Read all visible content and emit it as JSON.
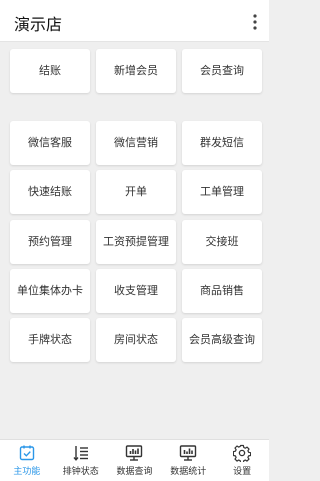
{
  "header": {
    "title": "演示店",
    "menu_icon": "more-vertical-icon"
  },
  "tiles": [
    {
      "label": "结账"
    },
    {
      "label": "新增会员"
    },
    {
      "label": "会员查询"
    },
    {
      "label": "微信客服"
    },
    {
      "label": "微信营销"
    },
    {
      "label": "群发短信"
    },
    {
      "label": "快速结账"
    },
    {
      "label": "开单"
    },
    {
      "label": "工单管理"
    },
    {
      "label": "预约管理"
    },
    {
      "label": "工资预提管理"
    },
    {
      "label": "交接班"
    },
    {
      "label": "单位集体办卡"
    },
    {
      "label": "收支管理"
    },
    {
      "label": "商品销售"
    },
    {
      "label": "手牌状态"
    },
    {
      "label": "房间状态"
    },
    {
      "label": "会员高级查询"
    }
  ],
  "tabbar": {
    "active_color": "#2b97e8",
    "items": [
      {
        "label": "主功能",
        "icon": "home-check-icon",
        "active": true
      },
      {
        "label": "排钟状态",
        "icon": "list-sort-icon",
        "active": false
      },
      {
        "label": "数据查询",
        "icon": "monitor-chart-icon",
        "active": false
      },
      {
        "label": "数据统计",
        "icon": "monitor-stats-icon",
        "active": false
      },
      {
        "label": "设置",
        "icon": "gear-icon",
        "active": false
      }
    ]
  }
}
